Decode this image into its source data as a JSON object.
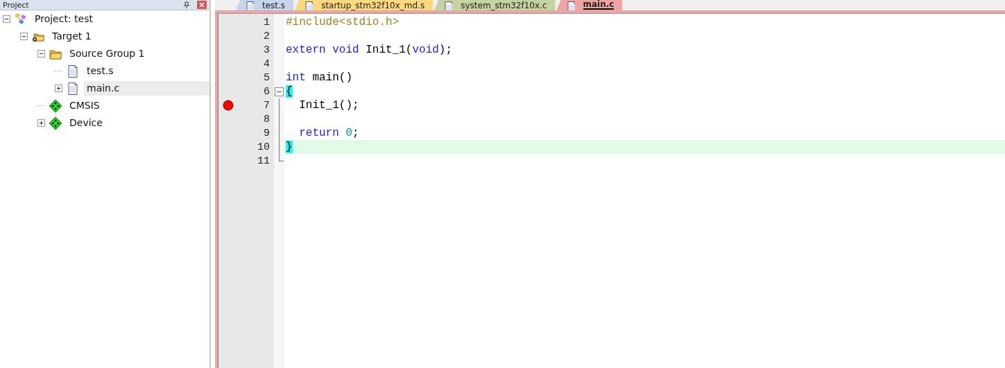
{
  "project_panel": {
    "title": "Project",
    "tree": [
      {
        "label": "Project: test",
        "kind": "project",
        "expanded": true,
        "selected": false,
        "children": [
          {
            "label": "Target 1",
            "kind": "target",
            "expanded": true,
            "selected": false,
            "children": [
              {
                "label": "Source Group 1",
                "kind": "folder",
                "expanded": true,
                "selected": false,
                "children": [
                  {
                    "label": "test.s",
                    "kind": "file",
                    "selected": false
                  },
                  {
                    "label": "main.c",
                    "kind": "file",
                    "expanded": false,
                    "selected": true
                  }
                ]
              },
              {
                "label": "CMSIS",
                "kind": "package",
                "selected": false
              },
              {
                "label": "Device",
                "kind": "package",
                "expanded": false,
                "selected": false
              }
            ]
          }
        ]
      }
    ]
  },
  "tabs": [
    {
      "label": "test.s",
      "color": "#c6d4ee",
      "selected": false
    },
    {
      "label": "startup_stm32f10x_md.s",
      "color": "#fcd97f",
      "selected": false
    },
    {
      "label": "system_stm32f10x.c",
      "color": "#c4d3a0",
      "selected": false
    },
    {
      "label": "main.c",
      "color": "#f0a3a3",
      "selected": true
    }
  ],
  "editor": {
    "lines": [
      {
        "number": "1",
        "tokens": [
          {
            "text": "#include<stdio.h>",
            "kind": "preprocessor"
          }
        ]
      },
      {
        "number": "2"
      },
      {
        "number": "3",
        "tokens": [
          {
            "text": "extern void",
            "kind": "keyword"
          },
          {
            "text": " Init_1(",
            "kind": "plain"
          },
          {
            "text": "void",
            "kind": "keyword"
          },
          {
            "text": ");",
            "kind": "plain"
          }
        ]
      },
      {
        "number": "4"
      },
      {
        "number": "5",
        "tokens": [
          {
            "text": "int",
            "kind": "keyword"
          },
          {
            "text": " main()",
            "kind": "plain"
          }
        ]
      },
      {
        "number": "6",
        "kind": "fold-start",
        "tokens": [
          {
            "text": "{",
            "kind": "brace"
          }
        ]
      },
      {
        "number": "7",
        "kind": "fold-body",
        "breakpoint": true,
        "tokens": [
          {
            "text": "  Init_1();",
            "kind": "plain"
          }
        ]
      },
      {
        "number": "8",
        "kind": "fold-body"
      },
      {
        "number": "9",
        "kind": "fold-body",
        "tokens": [
          {
            "text": "  return",
            "kind": "keyword"
          },
          {
            "text": " 0",
            "kind": "number"
          },
          {
            "text": ";",
            "kind": "plain"
          }
        ]
      },
      {
        "number": "10",
        "kind": "fold-body",
        "highlighted": true,
        "tokens": [
          {
            "text": "}",
            "kind": "brace"
          }
        ]
      },
      {
        "number": "11",
        "kind": "fold-end"
      }
    ]
  }
}
